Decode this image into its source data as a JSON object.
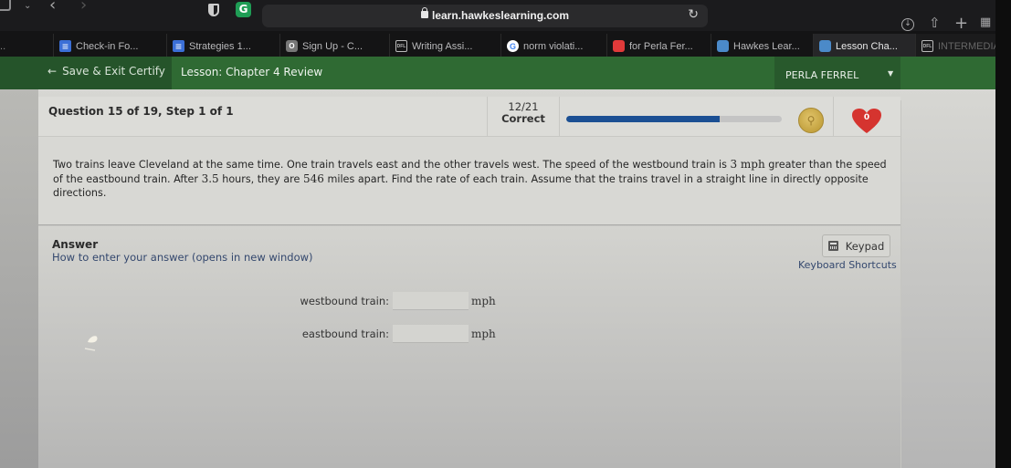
{
  "browser": {
    "url": "learn.hawkeslearning.com",
    "icons": {
      "sidebar": "sidebar-icon",
      "tab_group": "chevron-down-icon",
      "back": "back-arrow-icon",
      "forward": "forward-arrow-icon",
      "privacy": "shield-icon",
      "extension": "grammarly-icon",
      "lock": "lock-icon",
      "reload": "reload-icon",
      "downloads": "download-icon",
      "share": "share-icon",
      "new_tab": "plus-icon",
      "tab_overview": "grid-icon"
    },
    "tabs": [
      {
        "label": "Check-in Fo...",
        "favicon": "doc-icon"
      },
      {
        "label": "Strategies 1...",
        "favicon": "doc-icon"
      },
      {
        "label": "Sign Up - C...",
        "favicon": "o-icon"
      },
      {
        "label": "Writing Assi...",
        "favicon": "dfl-icon"
      },
      {
        "label": "norm violati...",
        "favicon": "google-icon"
      },
      {
        "label": "for Perla Fer...",
        "favicon": "canvas-icon"
      },
      {
        "label": "Hawkes Lear...",
        "favicon": "hawkes-icon"
      },
      {
        "label": "Lesson Cha...",
        "favicon": "hawkes-icon",
        "active": true
      },
      {
        "label": "INTERMEDIA...",
        "favicon": "dfl-icon"
      }
    ],
    "glyphs": {
      "back": "‹",
      "forward": "›",
      "chevron": "⌄",
      "reload": "↻",
      "share": "⇧",
      "plus": "+",
      "grid": "▦",
      "download": "↓",
      "grammarly": "G",
      "o": "O",
      "dfl": "DFL",
      "g": "G"
    }
  },
  "header": {
    "back_arrow": "←",
    "save_exit_label": "Save & Exit Certify",
    "lesson_title": "Lesson: Chapter 4 Review",
    "user_name": "PERLA FERREL",
    "user_caret": "▼"
  },
  "question": {
    "label": "Question 15 of 19, Step 1 of 1",
    "score": "12/21",
    "score_label": "Correct",
    "progress_percent": 71,
    "coin_glyph": "⚲",
    "lives": "0",
    "text_parts": [
      "Two trains leave Cleveland at the same time.  One train travels east and the other travels west.  The speed of the westbound train is ",
      "3",
      " mph",
      " greater than the speed of the eastbound train.  After ",
      "3.5",
      " hours, they are ",
      "546",
      " miles apart.  Find the rate of each train.  Assume that the trains travel in a straight line in directly opposite directions."
    ]
  },
  "answer": {
    "title": "Answer",
    "howto_link": "How to enter your answer (opens in new window)",
    "keypad_label": "Keypad",
    "shortcuts_link": "Keyboard Shortcuts",
    "fields": [
      {
        "label": "westbound train:",
        "value": "",
        "unit": "mph"
      },
      {
        "label": "eastbound train:",
        "value": "",
        "unit": "mph"
      }
    ]
  },
  "colors": {
    "header_green": "#2f6a33",
    "progress_fill": "#1b4f93",
    "heart_red": "#d5342f",
    "link_blue": "#34486e"
  }
}
